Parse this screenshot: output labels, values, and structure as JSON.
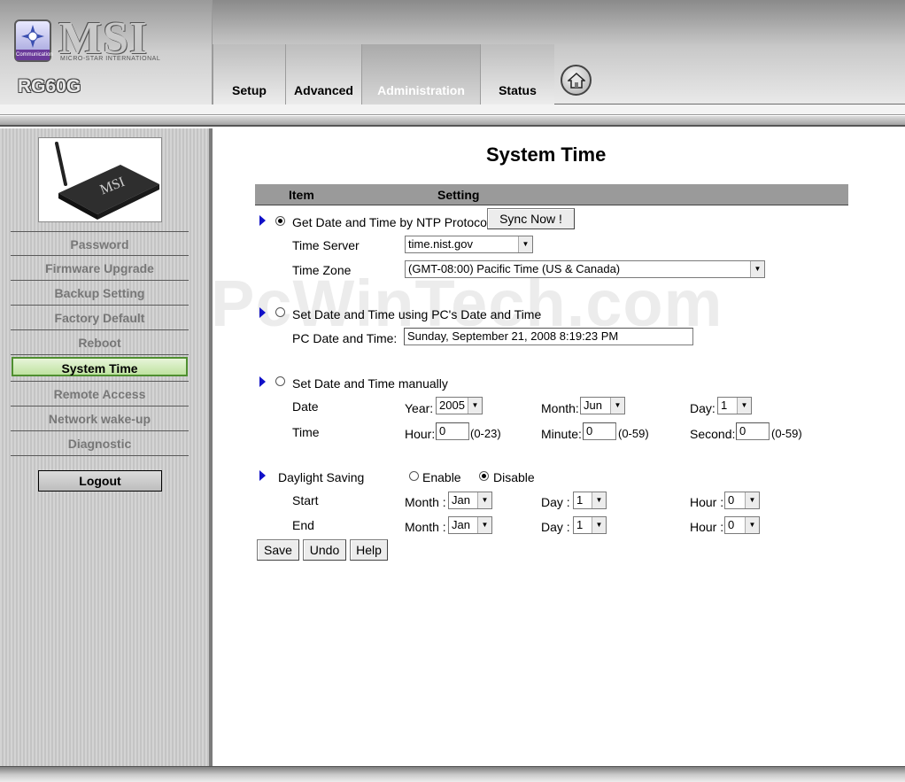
{
  "header": {
    "brand": "MSI",
    "brand_sub": "MICRO-STAR INTERNATIONAL",
    "badge": "Communication",
    "model": "RG60G",
    "tabs": [
      {
        "label": "Setup"
      },
      {
        "label": "Advanced"
      },
      {
        "label": "Administration"
      },
      {
        "label": "Status"
      }
    ]
  },
  "sidebar": {
    "items": [
      {
        "label": "Password"
      },
      {
        "label": "Firmware Upgrade"
      },
      {
        "label": "Backup Setting"
      },
      {
        "label": "Factory Default"
      },
      {
        "label": "Reboot"
      },
      {
        "label": "System Time"
      },
      {
        "label": "Remote Access"
      },
      {
        "label": "Network wake-up"
      },
      {
        "label": "Diagnostic"
      }
    ],
    "active": "System Time",
    "logout": "Logout"
  },
  "main": {
    "title": "System Time",
    "col_item": "Item",
    "col_setting": "Setting",
    "watermark": "PcWinTech.com",
    "ntp": {
      "label": "Get Date and Time by NTP Protocol",
      "sync_button": "Sync Now !",
      "server_label": "Time Server",
      "server_value": "time.nist.gov",
      "zone_label": "Time Zone",
      "zone_value": "(GMT-08:00) Pacific Time (US & Canada)"
    },
    "pc": {
      "label": "Set Date and Time using PC's Date and Time",
      "date_label": "PC Date and Time:",
      "date_value": "Sunday, September 21, 2008 8:19:23 PM"
    },
    "manual": {
      "label": "Set Date and Time manually",
      "date_label": "Date",
      "time_label": "Time",
      "year_label": "Year:",
      "year_value": "2005",
      "month_label": "Month:",
      "month_value": "Jun",
      "day_label": "Day:",
      "day_value": "1",
      "hour_label": "Hour:",
      "hour_value": "0",
      "hour_range": "(0-23)",
      "minute_label": "Minute:",
      "minute_value": "0",
      "minute_range": "(0-59)",
      "second_label": "Second:",
      "second_value": "0",
      "second_range": "(0-59)"
    },
    "dst": {
      "label": "Daylight Saving",
      "enable": "Enable",
      "disable": "Disable",
      "start_label": "Start",
      "end_label": "End",
      "month_label": "Month :",
      "day_label": "Day :",
      "hour_label": "Hour :",
      "start_month": "Jan",
      "start_day": "1",
      "start_hour": "0",
      "end_month": "Jan",
      "end_day": "1",
      "end_hour": "0"
    },
    "buttons": {
      "save": "Save",
      "undo": "Undo",
      "help": "Help"
    }
  }
}
